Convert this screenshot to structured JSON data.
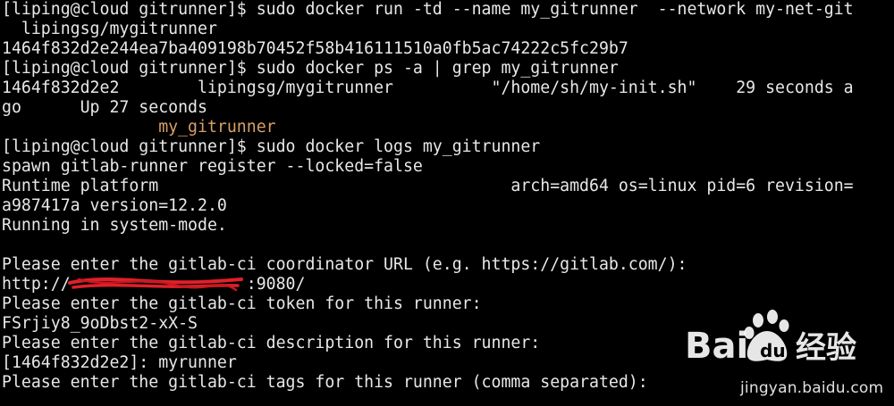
{
  "terminal": {
    "lines": [
      {
        "text": "[liping@cloud gitrunner]$ sudo docker run -td --name my_gitrunner  --network my-net-git"
      },
      {
        "text": "  lipingsg/mygitrunner"
      },
      {
        "text": "1464f832d2e244ea7ba409198b70452f58b416111510a0fb5ac74222c5fc29b7"
      },
      {
        "text": "[liping@cloud gitrunner]$ sudo docker ps -a | grep my_gitrunner"
      },
      {
        "text": "1464f832d2e2        lipingsg/mygitrunner          \"/home/sh/my-init.sh\"    29 seconds a"
      },
      {
        "text": "go      Up 27 seconds"
      },
      {
        "text": "                my_gitrunner",
        "color": "orange"
      },
      {
        "text": "[liping@cloud gitrunner]$ sudo docker logs my_gitrunner"
      },
      {
        "text": "spawn gitlab-runner register --locked=false"
      },
      {
        "text": "Runtime platform                                    arch=amd64 os=linux pid=6 revision="
      },
      {
        "text": "a987417a version=12.2.0"
      },
      {
        "text": "Running in system-mode."
      },
      {
        "text": ""
      },
      {
        "text": "Please enter the gitlab-ci coordinator URL (e.g. https://gitlab.com/):"
      },
      {
        "text": "http://                  :9080/"
      },
      {
        "text": "Please enter the gitlab-ci token for this runner:"
      },
      {
        "text": "FSrjiy8_9oDbst2-xX-S"
      },
      {
        "text": "Please enter the gitlab-ci description for this runner:"
      },
      {
        "text": "[1464f832d2e2]: myrunner"
      },
      {
        "text": "Please enter the gitlab-ci tags for this runner (comma separated):"
      }
    ]
  },
  "colors": {
    "background": "#000000",
    "foreground": "#e8e8e8",
    "container_name": "#d9a066",
    "redaction": "#e0202a"
  },
  "watermark": {
    "logo_text": "Bai du 经验",
    "url": "jingyan.baidu.com"
  }
}
